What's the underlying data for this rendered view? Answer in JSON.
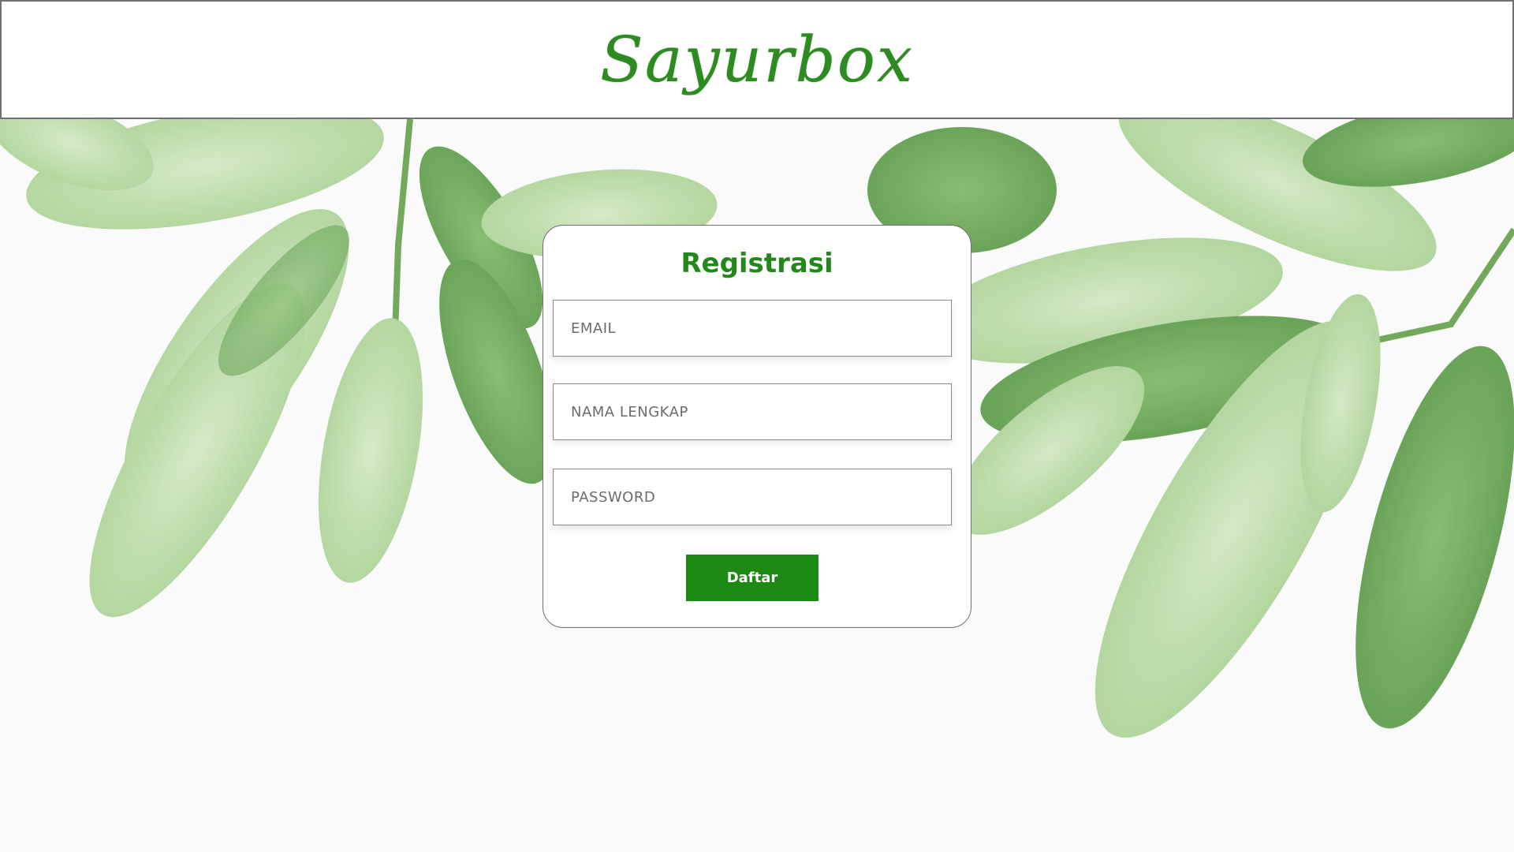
{
  "header": {
    "logo_text": "Sayurbox"
  },
  "form": {
    "title": "Registrasi",
    "fields": [
      {
        "placeholder": "EMAIL",
        "value": ""
      },
      {
        "placeholder": "NAMA LENGKAP",
        "value": ""
      },
      {
        "placeholder": "PASSWORD",
        "value": ""
      }
    ],
    "submit_label": "Daftar"
  },
  "colors": {
    "brand_green": "#2e8b22",
    "button_green": "#1a8a12",
    "leaf_light": "#b9d9a6",
    "leaf_dark": "#4f9a3c"
  }
}
